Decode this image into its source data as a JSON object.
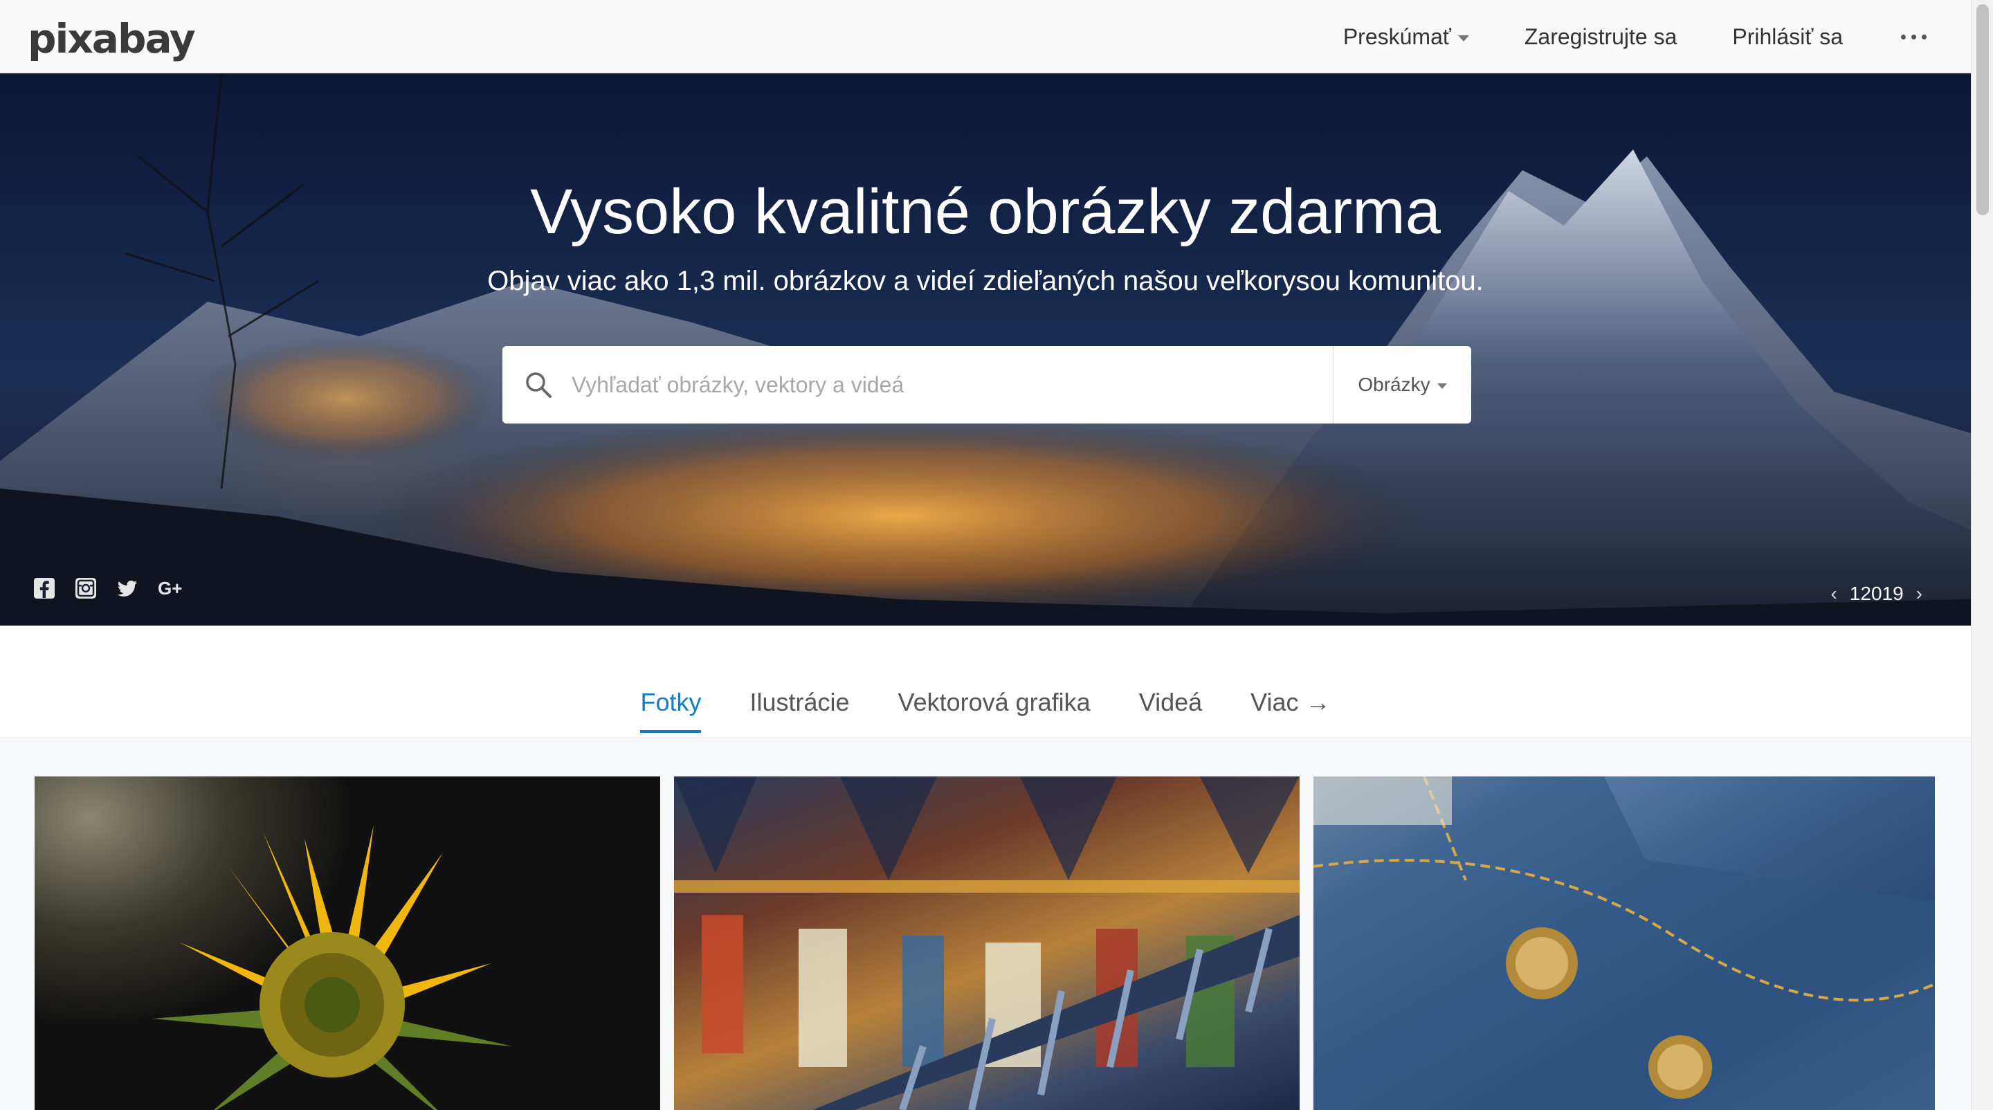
{
  "header": {
    "logo": "pixabay",
    "nav": {
      "explore": "Preskúmať",
      "register": "Zaregistrujte sa",
      "login": "Prihlásiť sa"
    }
  },
  "hero": {
    "title": "Vysoko kvalitné obrázky zdarma",
    "subtitle": "Objav viac ako 1,3 mil. obrázkov a videí zdieľaných našou veľkorysou komunitou.",
    "search": {
      "placeholder": "Vyhľadať obrázky, vektory a videá",
      "value": "",
      "type_selected": "Obrázky"
    },
    "social_icons": [
      "facebook-icon",
      "instagram-icon",
      "twitter-icon",
      "google-plus-icon"
    ],
    "pager": {
      "prev": "‹",
      "value": "12019",
      "next": "›"
    }
  },
  "tabs": [
    {
      "label": "Fotky",
      "active": true
    },
    {
      "label": "Ilustrácie",
      "active": false
    },
    {
      "label": "Vektorová grafika",
      "active": false
    },
    {
      "label": "Videá",
      "active": false
    },
    {
      "label": "Viac →",
      "active": false
    }
  ],
  "gallery": [
    "sunflower",
    "cathedral-painting",
    "denim-jeans"
  ],
  "colors": {
    "accent": "#1a7bbf",
    "topbar_bg": "#f9f9f9"
  }
}
